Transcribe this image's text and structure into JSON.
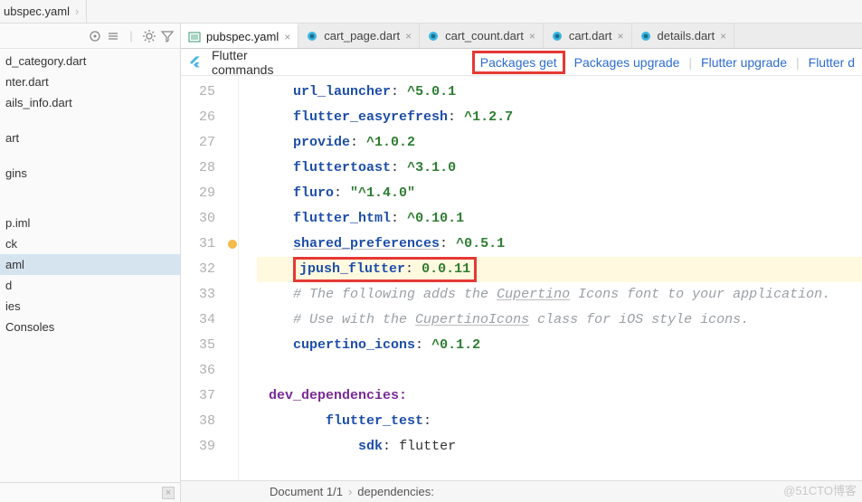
{
  "breadcrumb": {
    "item": "ubspec.yaml"
  },
  "sidebar": {
    "toolbar_icons": [
      "target-icon",
      "collapse-icon",
      "divider",
      "gear-icon",
      "filter-icon"
    ],
    "items": [
      "d_category.dart",
      "nter.dart",
      "ails_info.dart",
      "",
      "art",
      "",
      "gins",
      "",
      "",
      "p.iml",
      "ck",
      "aml",
      "d",
      "ies",
      " Consoles"
    ],
    "selected_index": 11
  },
  "tabs": [
    {
      "label": "pubspec.yaml",
      "icon": "yaml-file-icon",
      "active": true
    },
    {
      "label": "cart_page.dart",
      "icon": "dart-file-icon",
      "active": false
    },
    {
      "label": "cart_count.dart",
      "icon": "dart-file-icon",
      "active": false
    },
    {
      "label": "cart.dart",
      "icon": "dart-file-icon",
      "active": false
    },
    {
      "label": "details.dart",
      "icon": "dart-file-icon",
      "active": false
    }
  ],
  "flutter_bar": {
    "label": "Flutter commands",
    "links": [
      "Packages get",
      "Packages upgrade",
      "Flutter upgrade",
      "Flutter d"
    ]
  },
  "code": {
    "first_line_no": 25,
    "lines": [
      {
        "no": 25,
        "key": "url_launcher",
        "val": "^5.0.1"
      },
      {
        "no": 26,
        "key": "flutter_easyrefresh",
        "val": "^1.2.7"
      },
      {
        "no": 27,
        "key": "provide",
        "val": "^1.0.2"
      },
      {
        "no": 28,
        "key": "fluttertoast",
        "val": "^3.1.0"
      },
      {
        "no": 29,
        "key": "fluro",
        "val": "\"^1.4.0\"",
        "is_str": true
      },
      {
        "no": 30,
        "key": "flutter_html",
        "val": "^0.10.1"
      },
      {
        "no": 31,
        "key": "shared_preferences",
        "val": "^0.5.1",
        "bullet": true,
        "underline_key": true
      },
      {
        "no": 32,
        "key": "jpush_flutter",
        "val": "0.0.11",
        "boxed": true,
        "hl": true
      },
      {
        "no": 33,
        "comment": "# The following adds the Cupertino Icons font to your application.",
        "ul_word": "Cupertino"
      },
      {
        "no": 34,
        "comment": "# Use with the CupertinoIcons class for iOS style icons.",
        "ul_word": "CupertinoIcons"
      },
      {
        "no": 35,
        "key": "cupertino_icons",
        "val": "^0.1.2"
      },
      {
        "no": 36,
        "blank": true
      },
      {
        "no": 37,
        "section": "dev_dependencies",
        "fold": true
      },
      {
        "no": 38,
        "key": "flutter_test",
        "indent": 1,
        "noval": true
      },
      {
        "no": 39,
        "key": "sdk",
        "val": "flutter",
        "indent": 2,
        "idval": true,
        "cutoff": true
      }
    ]
  },
  "status": {
    "doc": "Document 1/1",
    "crumb": "dependencies:"
  },
  "watermark": "@51CTO博客"
}
